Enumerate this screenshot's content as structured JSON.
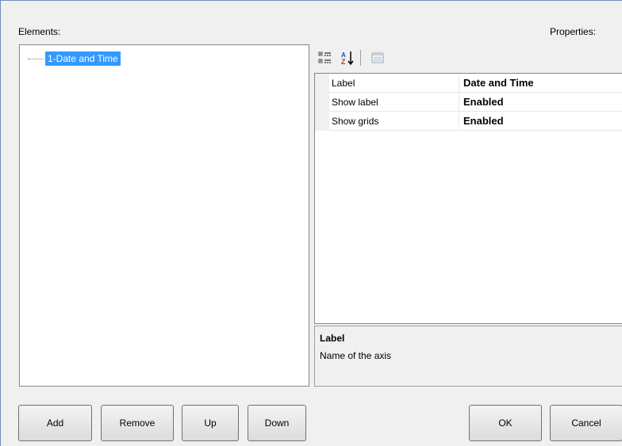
{
  "elements_label": "Elements:",
  "properties_label": "Properties:",
  "tree": {
    "items": [
      {
        "label": "1-Date and Time",
        "selected": true
      }
    ]
  },
  "toolbar": {
    "buttons": [
      {
        "name": "categorized-icon"
      },
      {
        "name": "sort-alphabetical-icon"
      },
      {
        "name": "property-pages-icon",
        "disabled": true
      }
    ]
  },
  "property_grid": {
    "rows": [
      {
        "name": "Label",
        "value": "Date and Time"
      },
      {
        "name": "Show label",
        "value": "Enabled"
      },
      {
        "name": "Show grids",
        "value": "Enabled"
      }
    ]
  },
  "description": {
    "title": "Label",
    "text": "Name of the axis"
  },
  "buttons": {
    "add": "Add",
    "remove": "Remove",
    "up": "Up",
    "down": "Down",
    "ok": "OK",
    "cancel": "Cancel"
  },
  "colors": {
    "selection": "#3399ff",
    "window_border": "#6f8fb8",
    "background": "#f0f0f0"
  }
}
